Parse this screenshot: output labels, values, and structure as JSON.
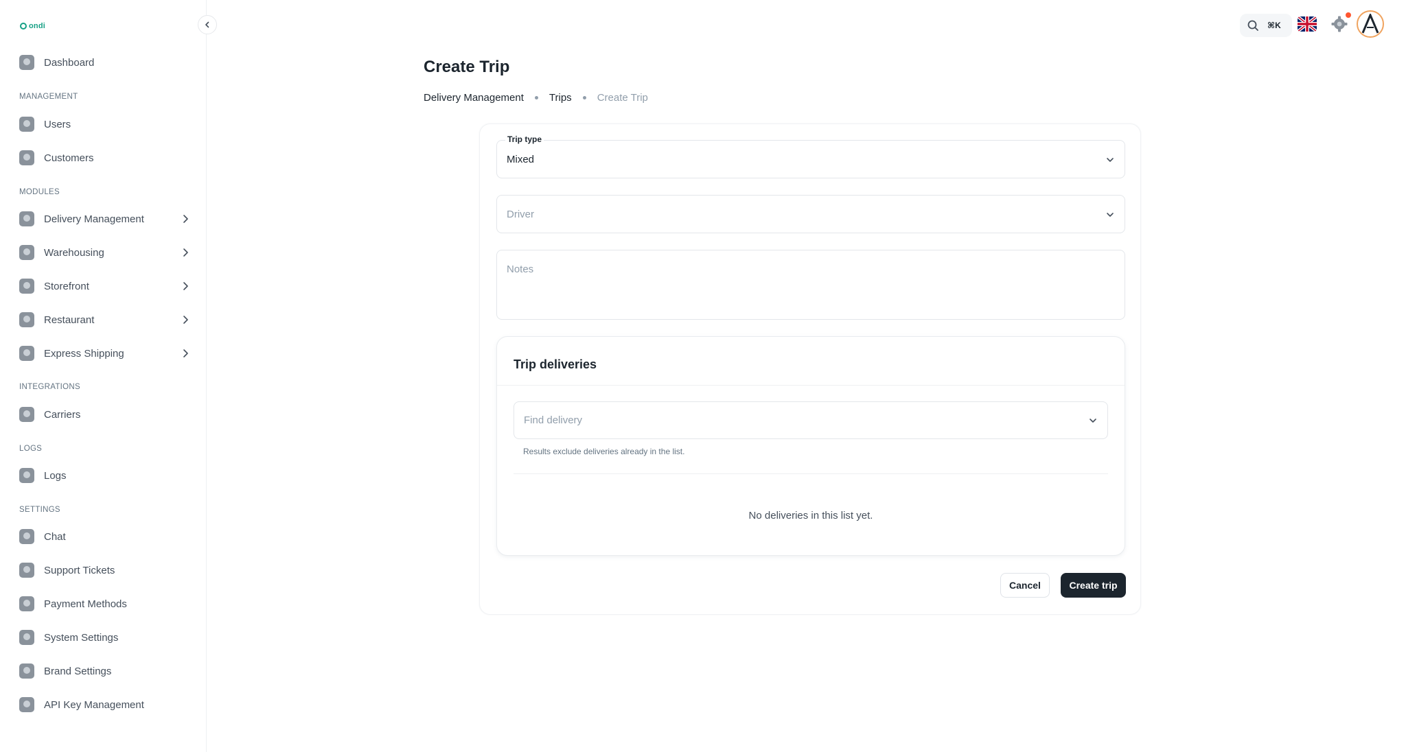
{
  "app": {
    "logo_text": "ondi"
  },
  "sidebar": {
    "dashboard": "Dashboard",
    "sections": {
      "management": "MANAGEMENT",
      "modules": "MODULES",
      "integrations": "INTEGRATIONS",
      "logs": "LOGS",
      "settings": "SETTINGS"
    },
    "items": {
      "users": "Users",
      "customers": "Customers",
      "delivery_management": "Delivery Management",
      "warehousing": "Warehousing",
      "storefront": "Storefront",
      "restaurant": "Restaurant",
      "express_shipping": "Express Shipping",
      "carriers": "Carriers",
      "logs": "Logs",
      "chat": "Chat",
      "support_tickets": "Support Tickets",
      "payment_methods": "Payment Methods",
      "system_settings": "System Settings",
      "brand_settings": "Brand Settings",
      "api_key_management": "API Key Management"
    }
  },
  "topbar": {
    "search_shortcut": "⌘K"
  },
  "page": {
    "title": "Create Trip",
    "breadcrumb": [
      "Delivery Management",
      "Trips",
      "Create Trip"
    ]
  },
  "form": {
    "trip_type": {
      "label": "Trip type",
      "value": "Mixed"
    },
    "driver": {
      "placeholder": "Driver"
    },
    "notes": {
      "placeholder": "Notes"
    },
    "deliveries": {
      "title": "Trip deliveries",
      "find_placeholder": "Find delivery",
      "helper": "Results exclude deliveries already in the list.",
      "empty": "No deliveries in this list yet."
    },
    "cancel_label": "Cancel",
    "submit_label": "Create trip"
  },
  "colors": {
    "accent": "#16a085",
    "primary_button": "#1c252e",
    "notification": "#ff5630"
  }
}
